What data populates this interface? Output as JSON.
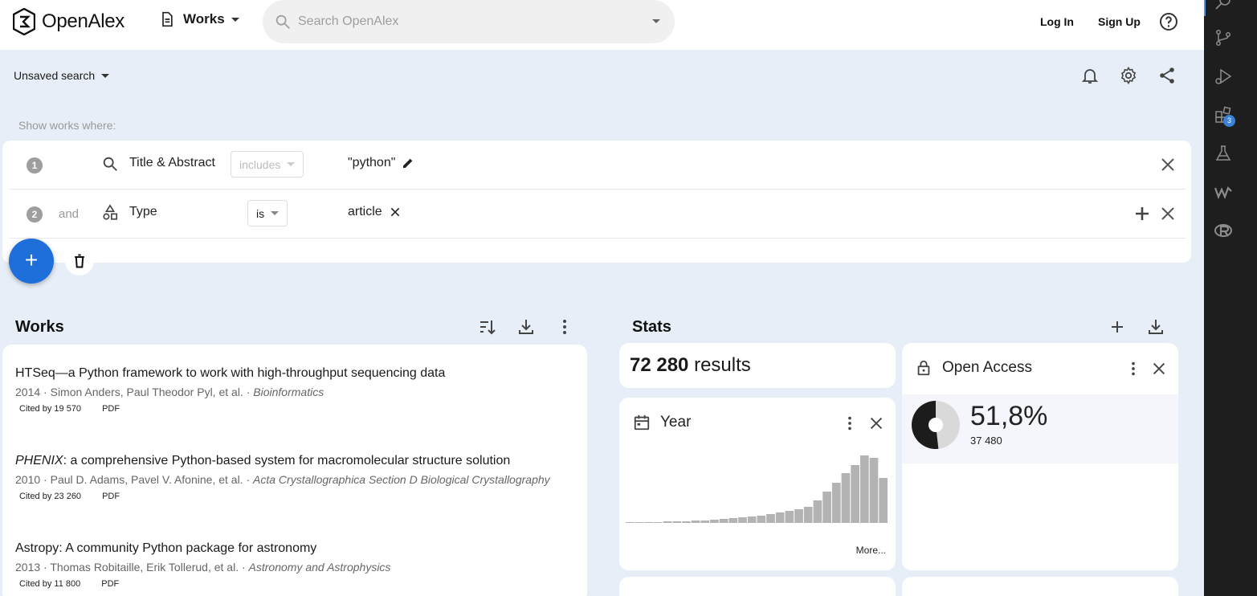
{
  "brand": {
    "name": "OpenAlex"
  },
  "header": {
    "entity_label": "Works",
    "search_placeholder": "Search OpenAlex",
    "login": "Log In",
    "signup": "Sign Up"
  },
  "saved_search": {
    "label": "Unsaved search"
  },
  "filters": {
    "heading": "Show works where:",
    "rows": [
      {
        "num": "1",
        "conjunction": "",
        "key": "Title & Abstract",
        "operator": "includes",
        "value": "\"python\""
      },
      {
        "num": "2",
        "conjunction": "and",
        "key": "Type",
        "operator": "is",
        "value": "article"
      }
    ]
  },
  "works_section": {
    "title": "Works",
    "items": [
      {
        "title": "HTSeq—a Python framework to work with high-throughput sequencing data",
        "title_italic": "",
        "year": "2014",
        "authors": "Simon Anders, Paul Theodor Pyl, et al.",
        "venue": "Bioinformatics",
        "cited": "Cited by 19 570",
        "pdf": "PDF"
      },
      {
        "title": ": a comprehensive Python-based system for macromolecular structure solution",
        "title_italic": "PHENIX",
        "year": "2010",
        "authors": "Paul D. Adams, Pavel V. Afonine, et al.",
        "venue": "Acta Crystallographica Section D Biological Crystallography",
        "cited": "Cited by 23 260",
        "pdf": "PDF"
      },
      {
        "title": "Astropy: A community Python package for astronomy",
        "title_italic": "",
        "year": "2013",
        "authors": "Thomas Robitaille, Erik Tollerud, et al.",
        "venue": "Astronomy and Astrophysics",
        "cited": "Cited by 11 800",
        "pdf": "PDF"
      }
    ]
  },
  "stats": {
    "title": "Stats",
    "results_count": "72 280",
    "results_label": "results",
    "year_title": "Year",
    "more_label": "More...",
    "open_access": {
      "title": "Open Access",
      "percent": "51,8%",
      "count": "37 480",
      "fraction": 0.518
    }
  },
  "vscode": {
    "badge": "3"
  },
  "chart_data": {
    "type": "bar",
    "title": "Year",
    "values": [
      1,
      1,
      1,
      1,
      2,
      2,
      2,
      3,
      3,
      4,
      5,
      6,
      7,
      8,
      9,
      11,
      13,
      15,
      17,
      20,
      28,
      39,
      50,
      62,
      72,
      84,
      81,
      56
    ],
    "color": "#b3b3b3"
  }
}
